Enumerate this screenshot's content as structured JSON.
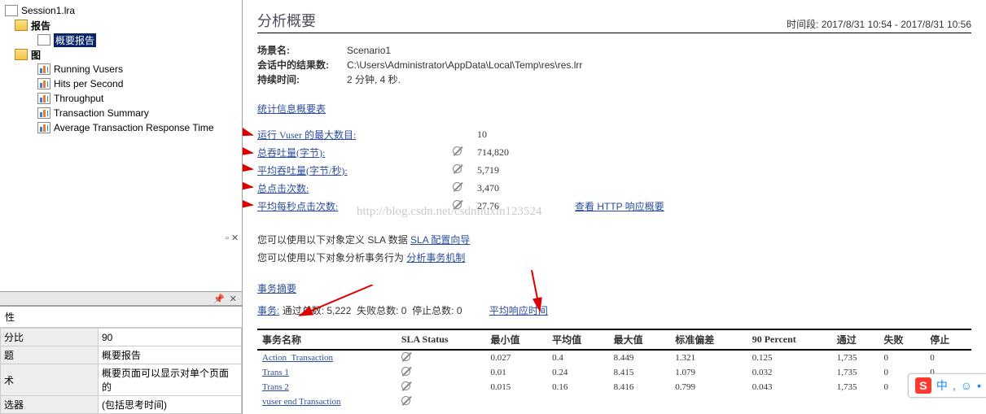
{
  "tree": {
    "session": "Session1.lra",
    "reports_label": "报告",
    "summary_report": "概要报告",
    "graphs_label": "图",
    "graphs": [
      "Running Vusers",
      "Hits per Second",
      "Throughput",
      "Transaction Summary",
      "Average Transaction Response Time"
    ]
  },
  "props_panel": {
    "pin_label": "▢ ✕",
    "title": "性",
    "rows": {
      "0": {
        "k": "分比",
        "v": "90"
      },
      "1": {
        "k": "题",
        "v": "概要报告"
      },
      "2": {
        "k": "术",
        "v": "概要页面可以显示对单个页面的"
      },
      "3": {
        "k": "选器",
        "v": "(包括思考时间)"
      }
    }
  },
  "header": {
    "title": "分析概要",
    "period_label": "时间段:",
    "period": "2017/8/31 10:54 - 2017/8/31 10:56"
  },
  "meta": {
    "scene_label": "场景名:",
    "scene": "Scenario1",
    "path_label": "会话中的结果数:",
    "path": "C:\\Users\\Administrator\\AppData\\Local\\Temp\\res\\res.lrr",
    "duration_label": "持续时间:",
    "duration": "2 分钟, 4 秒."
  },
  "stats_title": "统计信息概要表",
  "stats": {
    "0": {
      "label": "运行 Vuser 的最大数目:",
      "null": false,
      "value": "10",
      "extra": ""
    },
    "1": {
      "label": "总吞吐量(字节):",
      "null": true,
      "value": "714,820",
      "extra": ""
    },
    "2": {
      "label": "平均吞吐量(字节/秒):",
      "null": true,
      "value": "5,719",
      "extra": ""
    },
    "3": {
      "label": "总点击次数:",
      "null": true,
      "value": "3,470",
      "extra": ""
    },
    "4": {
      "label": "平均每秒点击次数:",
      "null": true,
      "value": "27.76",
      "extra": "查看 HTTP 响应概要"
    }
  },
  "watermark": "http://blog.csdn.net/csdnliuxin123524",
  "sla": {
    "line1_a": "您可以使用以下对象定义 SLA 数据 ",
    "line1_link": "SLA 配置向导",
    "line2_a": "您可以使用以下对象分析事务行为 ",
    "line2_link": "分析事务机制"
  },
  "biz": {
    "title": "事务摘要",
    "prefix": "事务:",
    "pass_label": "通过总数:",
    "pass": "5,222",
    "fail_label": "失败总数:",
    "fail": "0",
    "stop_label": "停止总数:",
    "stop": "0",
    "avg_link": "平均响应时间"
  },
  "table": {
    "headers": {
      "name": "事务名称",
      "sla": "SLA Status",
      "min": "最小值",
      "avg": "平均值",
      "max": "最大值",
      "std": "标准偏差",
      "p90": "90 Percent",
      "pass": "通过",
      "fail": "失败",
      "stop": "停止"
    },
    "rows": {
      "0": {
        "name": "Action_Transaction",
        "min": "0.027",
        "avg": "0.4",
        "max": "8.449",
        "std": "1.321",
        "p90": "0.125",
        "pass": "1,735",
        "fail": "0",
        "stop": "0"
      },
      "1": {
        "name": "Trans 1",
        "min": "0.01",
        "avg": "0.24",
        "max": "8.415",
        "std": "1.079",
        "p90": "0.032",
        "pass": "1,735",
        "fail": "0",
        "stop": "0"
      },
      "2": {
        "name": "Trans 2",
        "min": "0.015",
        "avg": "0.16",
        "max": "8.416",
        "std": "0.799",
        "p90": "0.043",
        "pass": "1,735",
        "fail": "0",
        "stop": "0"
      },
      "3": {
        "name": "vuser end Transaction",
        "min": "",
        "avg": "",
        "max": "",
        "std": "",
        "p90": "",
        "pass": "",
        "fail": "",
        "stop": ""
      }
    }
  },
  "ime": {
    "s": "S",
    "txt": "中",
    "dot": ",",
    "smile": "☺",
    "more": "•"
  }
}
